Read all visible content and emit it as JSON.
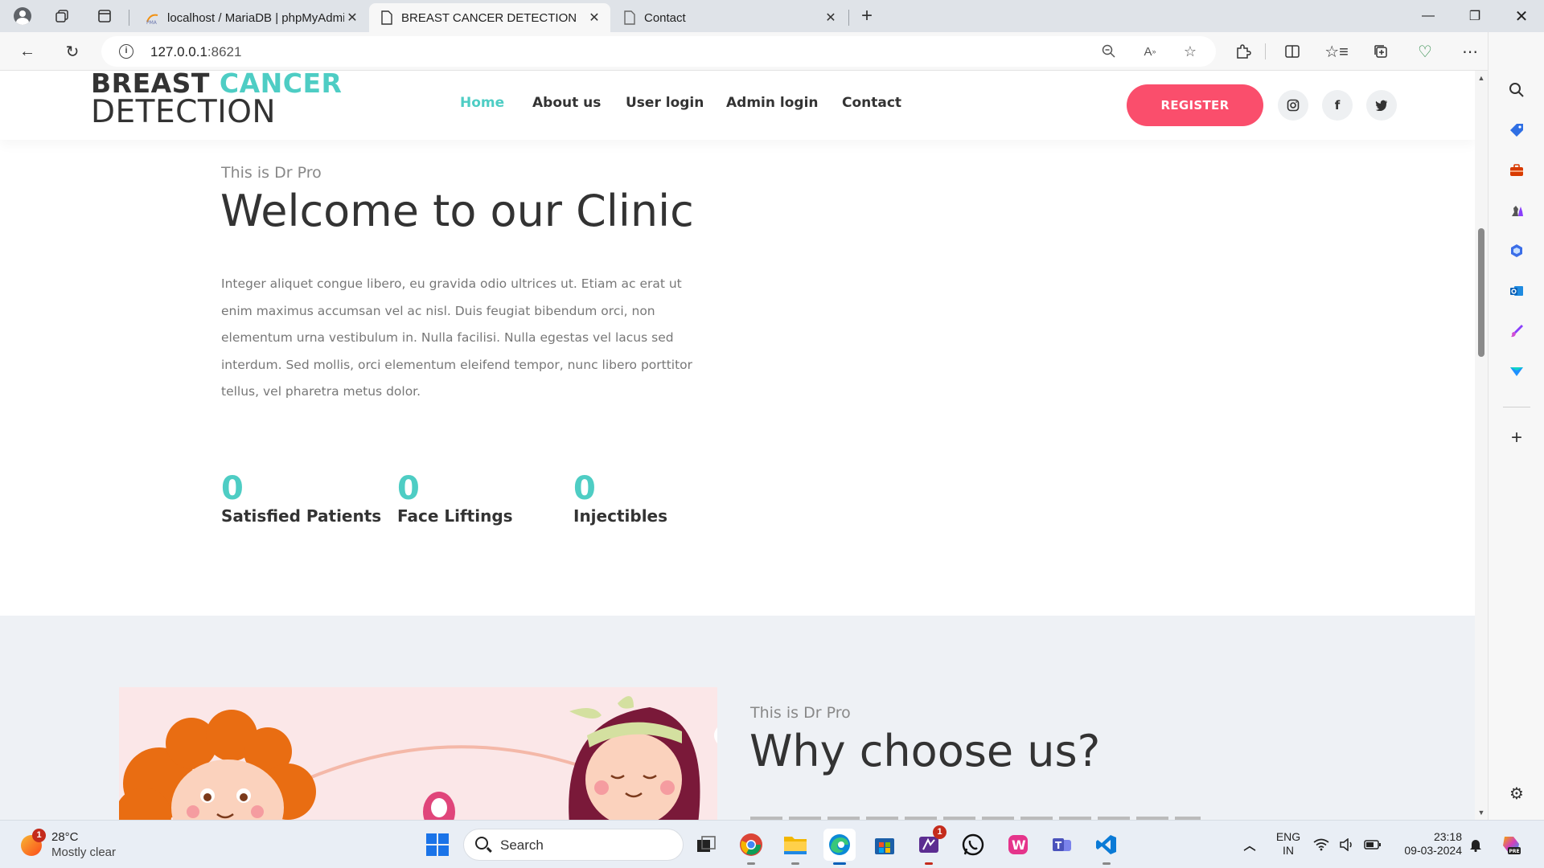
{
  "browser": {
    "tabs": [
      {
        "title": "localhost / MariaDB | phpMyAdmin",
        "icon": "phpmyadmin-icon",
        "active": false
      },
      {
        "title": "BREAST CANCER DETECTION",
        "icon": "page-icon",
        "active": true
      },
      {
        "title": "Contact",
        "icon": "page-icon",
        "active": false
      }
    ],
    "url": {
      "host": "127.0.0.1",
      "port": ":8621"
    }
  },
  "site": {
    "logo": {
      "line1_dark": "BREAST ",
      "line1_accent": "CANCER",
      "line2": "DETECTION"
    },
    "nav": [
      "Home",
      "About us",
      "User login",
      "Admin login",
      "Contact"
    ],
    "register_label": "REGISTER",
    "social": [
      "instagram-icon",
      "facebook-icon",
      "twitter-icon"
    ],
    "hero": {
      "subtitle": "This is Dr Pro",
      "title": "Welcome to our Clinic",
      "text": "Integer aliquet congue libero, eu gravida odio ultrices ut. Etiam ac erat ut enim maximus accumsan vel ac nisl. Duis feugiat bibendum orci, non elementum urna vestibulum in. Nulla facilisi. Nulla egestas vel lacus sed interdum. Sed mollis, orci elementum eleifend tempor, nunc libero porttitor tellus, vel pharetra metus dolor."
    },
    "stats": [
      {
        "value": "0",
        "label": "Satisfied Patients"
      },
      {
        "value": "0",
        "label": "Face Liftings"
      },
      {
        "value": "0",
        "label": "Injectibles"
      }
    ],
    "why": {
      "subtitle": "This is Dr Pro",
      "title": "Why choose us?"
    },
    "accent_color": "#4ecdc4",
    "register_color": "#fa4e6c"
  },
  "taskbar": {
    "weather": {
      "temp": "28°C",
      "condition": "Mostly clear",
      "badge": "1"
    },
    "search_label": "Search",
    "lang": {
      "line1": "ENG",
      "line2": "IN"
    },
    "time": "23:18",
    "date": "09-03-2024",
    "teams_badge": "1"
  }
}
